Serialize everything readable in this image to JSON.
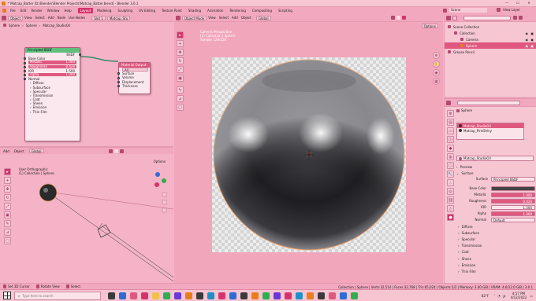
{
  "window": {
    "title": "* Matcap_Batter [D:\\Blender\\Blender Projects\\Matcap_Batter.blend] - Blender 3.0.1"
  },
  "menu": {
    "items": [
      "File",
      "Edit",
      "Render",
      "Window",
      "Help"
    ],
    "workspaces": [
      "Layout",
      "Modeling",
      "Sculpting",
      "UV Editing",
      "Texture Paint",
      "Shading",
      "Animation",
      "Rendering",
      "Compositing",
      "Scripting"
    ],
    "active_workspace": "Layout",
    "scene_label": "Scene",
    "view_layer_label": "View Layer"
  },
  "node_editor": {
    "header": {
      "editor_type": "Object",
      "view": "View",
      "select": "Select",
      "add": "Add",
      "node": "Node",
      "use_nodes": "Use Nodes",
      "slot": "Slot 1",
      "material": "Matcap_Stu"
    },
    "breadcrumb": [
      "Sphere",
      "Sphere",
      "Matcap_StudioOil"
    ],
    "bsdf_node": {
      "title": "Principled BSDF",
      "output": "BSDF",
      "rows": [
        {
          "label": "Base Color",
          "value": ""
        },
        {
          "label": "Metallic",
          "value": "1.000"
        },
        {
          "label": "Roughness",
          "value": "0.420"
        },
        {
          "label": "IOR",
          "value": "1.500"
        },
        {
          "label": "Alpha",
          "value": "1.000"
        },
        {
          "label": "Normal",
          "value": ""
        }
      ],
      "pink_rows": [
        1,
        2,
        4
      ],
      "subs": [
        "Diffuse",
        "Subsurface",
        "Specular",
        "Transmission",
        "Coat",
        "Sheen",
        "Emission",
        "Thin Film"
      ]
    },
    "output_node": {
      "title": "Material Output",
      "target": "All",
      "sockets": [
        "Surface",
        "Volume",
        "Displacement",
        "Thickness"
      ]
    }
  },
  "left_view": {
    "header": {
      "add": "Add",
      "object": "Object",
      "orientation": "Global"
    },
    "info": [
      "User Orthographic",
      "(1) Collection | Sphere"
    ],
    "options": "Options"
  },
  "viewport": {
    "header": {
      "mode": "Object Mode",
      "view": "View",
      "select": "Select",
      "add": "Add",
      "object": "Object",
      "orientation": "Global",
      "options": "Options"
    },
    "info": [
      "Camera Perspective",
      "(1) Collection | Sphere",
      "Sample 128/128"
    ]
  },
  "outliner": {
    "search_placeholder": "",
    "items": [
      {
        "label": "Scene Collection",
        "level": 0
      },
      {
        "label": "Collection",
        "level": 1
      },
      {
        "label": "Camera",
        "level": 2
      },
      {
        "label": "Sphere",
        "level": 2
      },
      {
        "label": "Grease Pencil",
        "level": 0
      }
    ],
    "selected_index": 3
  },
  "properties": {
    "object": "Sphere",
    "material_slots": [
      "Matcap_StudioOil",
      "Matcap_PinkShiny"
    ],
    "active_material": "Matcap_StudioOil",
    "preview_label": "Preview",
    "surface_section": "Surface",
    "surface_shader_label": "Surface",
    "surface_shader": "Principled BSDF",
    "fields": [
      {
        "label": "Base Color",
        "value": "",
        "pink": false,
        "color": "#444444"
      },
      {
        "label": "Metallic",
        "value": "1.000",
        "pink": true
      },
      {
        "label": "Roughness",
        "value": "0.420",
        "pink": true
      },
      {
        "label": "IOR",
        "value": "1.500",
        "pink": false
      },
      {
        "label": "Alpha",
        "value": "1.000",
        "pink": true
      },
      {
        "label": "Normal",
        "value": "Default",
        "pink": false
      }
    ],
    "subs": [
      "Diffuse",
      "Subsurface",
      "Specular",
      "Transmission",
      "Coat",
      "Sheen",
      "Emission",
      "Thin Film"
    ]
  },
  "statusbar": {
    "left": [
      "Set 3D Cursor",
      "Rotate View",
      "Select"
    ],
    "right": "Collection | Sphere | Verts:32,514 | Faces:32,768 | Tris:65,024 | Objects:1/2 | Memory: 3.40 GiB | VRAM: 4.6/12.0 GiB | 3.0.1"
  },
  "taskbar": {
    "search_placeholder": "Type here to search",
    "time": "4:57 PM",
    "date": "4/12/2022",
    "weather": "82°F"
  },
  "colors": {
    "accent": "#d6336c",
    "panel": "#f4b3c6",
    "header": "#f2a9bf",
    "field_pink": "#e0587f"
  }
}
